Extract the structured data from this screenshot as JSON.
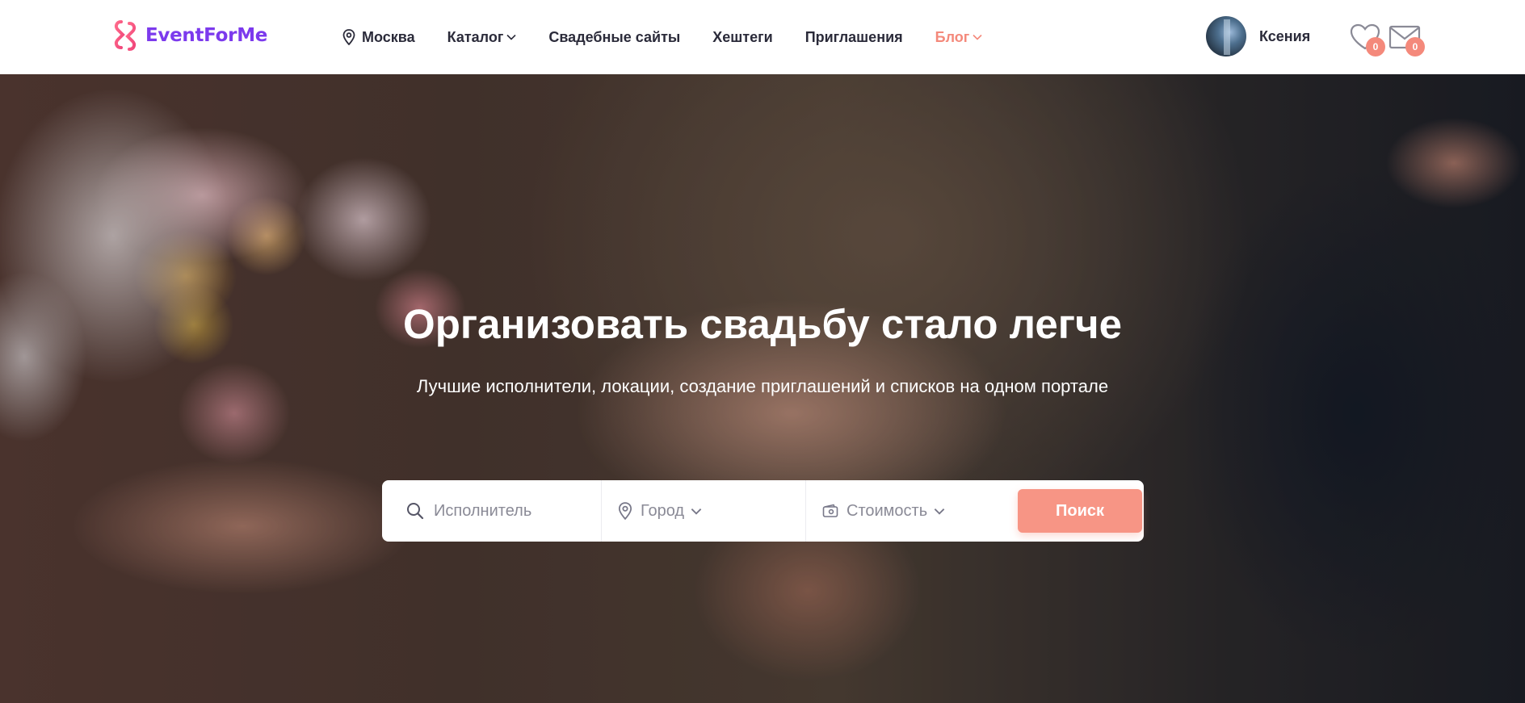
{
  "brand": {
    "name": "EventForMe"
  },
  "nav": {
    "city": "Москва",
    "catalog": "Каталог",
    "wedding_sites": "Свадебные сайты",
    "hashtags": "Хештеги",
    "invitations": "Приглашения",
    "blog": "Блог"
  },
  "user": {
    "name": "Ксения"
  },
  "counters": {
    "favorites": "0",
    "messages": "0"
  },
  "colors": {
    "accent": "#f4897b",
    "brand": "#7c3aed"
  },
  "hero": {
    "title": "Организовать свадьбу стало легче",
    "subtitle": "Лучшие исполнители, локации, создание приглашений и списков на одном портале"
  },
  "search": {
    "performer_placeholder": "Исполнитель",
    "city_label": "Город",
    "price_label": "Стоимость",
    "button": "Поиск"
  },
  "icons": [
    "logo-icon",
    "location-pin-icon",
    "chevron-down-icon",
    "heart-icon",
    "envelope-icon",
    "search-icon",
    "wallet-icon"
  ]
}
